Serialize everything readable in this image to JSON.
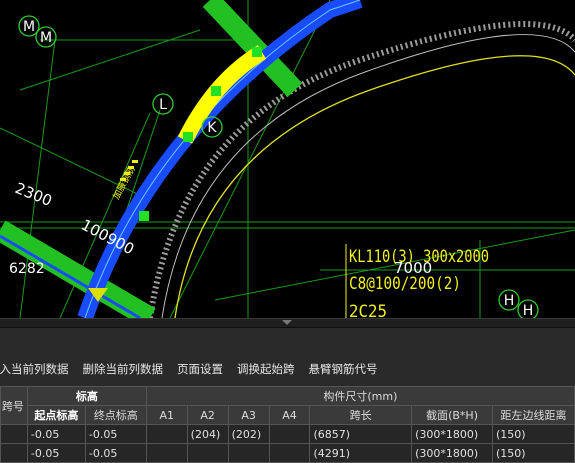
{
  "drawing": {
    "axis_labels": [
      "M",
      "M",
      "L",
      "K",
      "H",
      "H"
    ],
    "dimensions": [
      "2300",
      "100900",
      "6282",
      "7000"
    ],
    "beam_annotation": [
      "KL110(3) 300x2000",
      "C8@100/200(2)",
      "2C25"
    ],
    "side_annotation": "加腋钢筋"
  },
  "toolbar": {
    "buttons": [
      "插入当前列数据",
      "删除当前列数据",
      "页面设置",
      "调换起始跨",
      "悬臂钢筋代号"
    ]
  },
  "table": {
    "group_headers": {
      "index": "跨号",
      "elevation": "标高",
      "member_size": "构件尺寸(mm)"
    },
    "columns": [
      "起点标高",
      "终点标高",
      "A1",
      "A2",
      "A3",
      "A4",
      "跨长",
      "截面(B*H)",
      "距左边线距离"
    ],
    "rows": [
      [
        "-0.05",
        "-0.05",
        "",
        "(204)",
        "(202)",
        "",
        "(6857)",
        "(300*1800)",
        "(150)"
      ],
      [
        "-0.05",
        "-0.05",
        "",
        "",
        "",
        "",
        "(4291)",
        "(300*1800)",
        "(150)"
      ]
    ]
  },
  "colors": {
    "canvas_bg": "#000000",
    "grid_line": "#1fae1f",
    "beam_blue": "#1a4cff",
    "beam_yellow": "#ffff00",
    "beam_green": "#22c022",
    "axis_circle": "#33cc33",
    "annotation_yellow": "#f2f21a"
  }
}
